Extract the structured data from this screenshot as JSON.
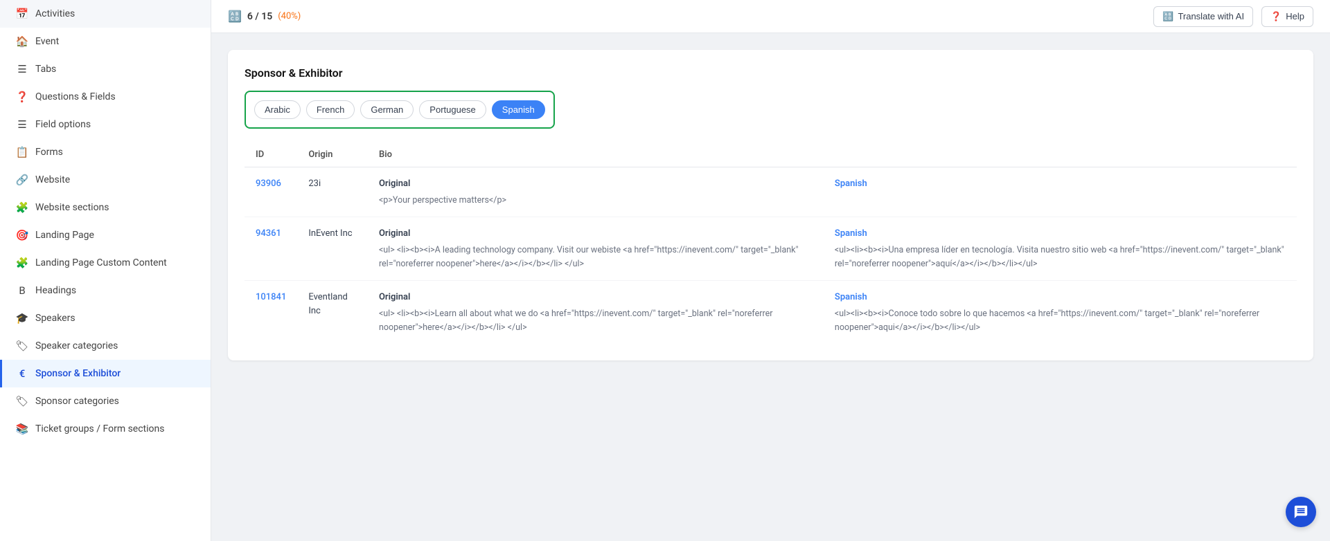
{
  "sidebar": {
    "items": [
      {
        "id": "activities",
        "label": "Activities",
        "icon": "📅",
        "active": false
      },
      {
        "id": "event",
        "label": "Event",
        "icon": "🏠",
        "active": false
      },
      {
        "id": "tabs",
        "label": "Tabs",
        "icon": "☰",
        "active": false
      },
      {
        "id": "questions-fields",
        "label": "Questions & Fields",
        "icon": "❓",
        "active": false
      },
      {
        "id": "field-options",
        "label": "Field options",
        "icon": "☰",
        "active": false
      },
      {
        "id": "forms",
        "label": "Forms",
        "icon": "📋",
        "active": false
      },
      {
        "id": "website",
        "label": "Website",
        "icon": "🔗",
        "active": false
      },
      {
        "id": "website-sections",
        "label": "Website sections",
        "icon": "🧩",
        "active": false
      },
      {
        "id": "landing-page",
        "label": "Landing Page",
        "icon": "🎯",
        "active": false
      },
      {
        "id": "landing-page-custom",
        "label": "Landing Page Custom Content",
        "icon": "🧩",
        "active": false
      },
      {
        "id": "headings",
        "label": "Headings",
        "icon": "B",
        "active": false
      },
      {
        "id": "speakers",
        "label": "Speakers",
        "icon": "🎓",
        "active": false
      },
      {
        "id": "speaker-categories",
        "label": "Speaker categories",
        "icon": "🏷",
        "active": false
      },
      {
        "id": "sponsor-exhibitor",
        "label": "Sponsor & Exhibitor",
        "icon": "€",
        "active": true
      },
      {
        "id": "sponsor-categories",
        "label": "Sponsor categories",
        "icon": "🏷",
        "active": false
      },
      {
        "id": "ticket-groups",
        "label": "Ticket groups / Form sections",
        "icon": "📚",
        "active": false
      }
    ]
  },
  "topbar": {
    "progress_current": "6",
    "progress_total": "15",
    "progress_percent": "(40%)",
    "translate_label": "Translate with AI",
    "help_label": "Help"
  },
  "card": {
    "title": "Sponsor & Exhibitor",
    "languages": [
      {
        "id": "arabic",
        "label": "Arabic",
        "active": false
      },
      {
        "id": "french",
        "label": "French",
        "active": false
      },
      {
        "id": "german",
        "label": "German",
        "active": false
      },
      {
        "id": "portuguese",
        "label": "Portuguese",
        "active": false
      },
      {
        "id": "spanish",
        "label": "Spanish",
        "active": true
      }
    ],
    "table": {
      "columns": [
        "ID",
        "Origin",
        "Bio"
      ],
      "rows": [
        {
          "id": "93906",
          "origin": "23i",
          "bio_label": "Original",
          "bio_content": "<p>Your perspective matters</p>",
          "translation_lang": "Spanish",
          "translation_content": ""
        },
        {
          "id": "94361",
          "origin": "InEvent Inc",
          "bio_label": "Original",
          "bio_content": "<ul> <li><b><i>A leading technology company. Visit our webiste <a href=\"https://inevent.com/\" target=\"_blank\" rel=\"noreferrer noopener\">here</a></i></b></li> </ul>",
          "translation_lang": "Spanish",
          "translation_content": "<ul><li><b><i>Una empresa líder en tecnología. Visita nuestro sitio web <a href=\"https://inevent.com/\" target=\"_blank\" rel=\"noreferrer noopener\">aquí</a></i></b></li></ul>"
        },
        {
          "id": "101841",
          "origin": "Eventland Inc",
          "bio_label": "Original",
          "bio_content": "<ul> <li><b><i>Learn all about what we do <a href=\"https://inevent.com/\" target=\"_blank\" rel=\"noreferrer noopener\">here</a></i></b></li> </ul>",
          "translation_lang": "Spanish",
          "translation_content": "<ul><li><b><i>Conoce todo sobre lo que hacemos <a href=\"https://inevent.com/\" target=\"_blank\" rel=\"noreferrer noopener\">aqui</a></i></b></li></ul>"
        }
      ]
    }
  }
}
